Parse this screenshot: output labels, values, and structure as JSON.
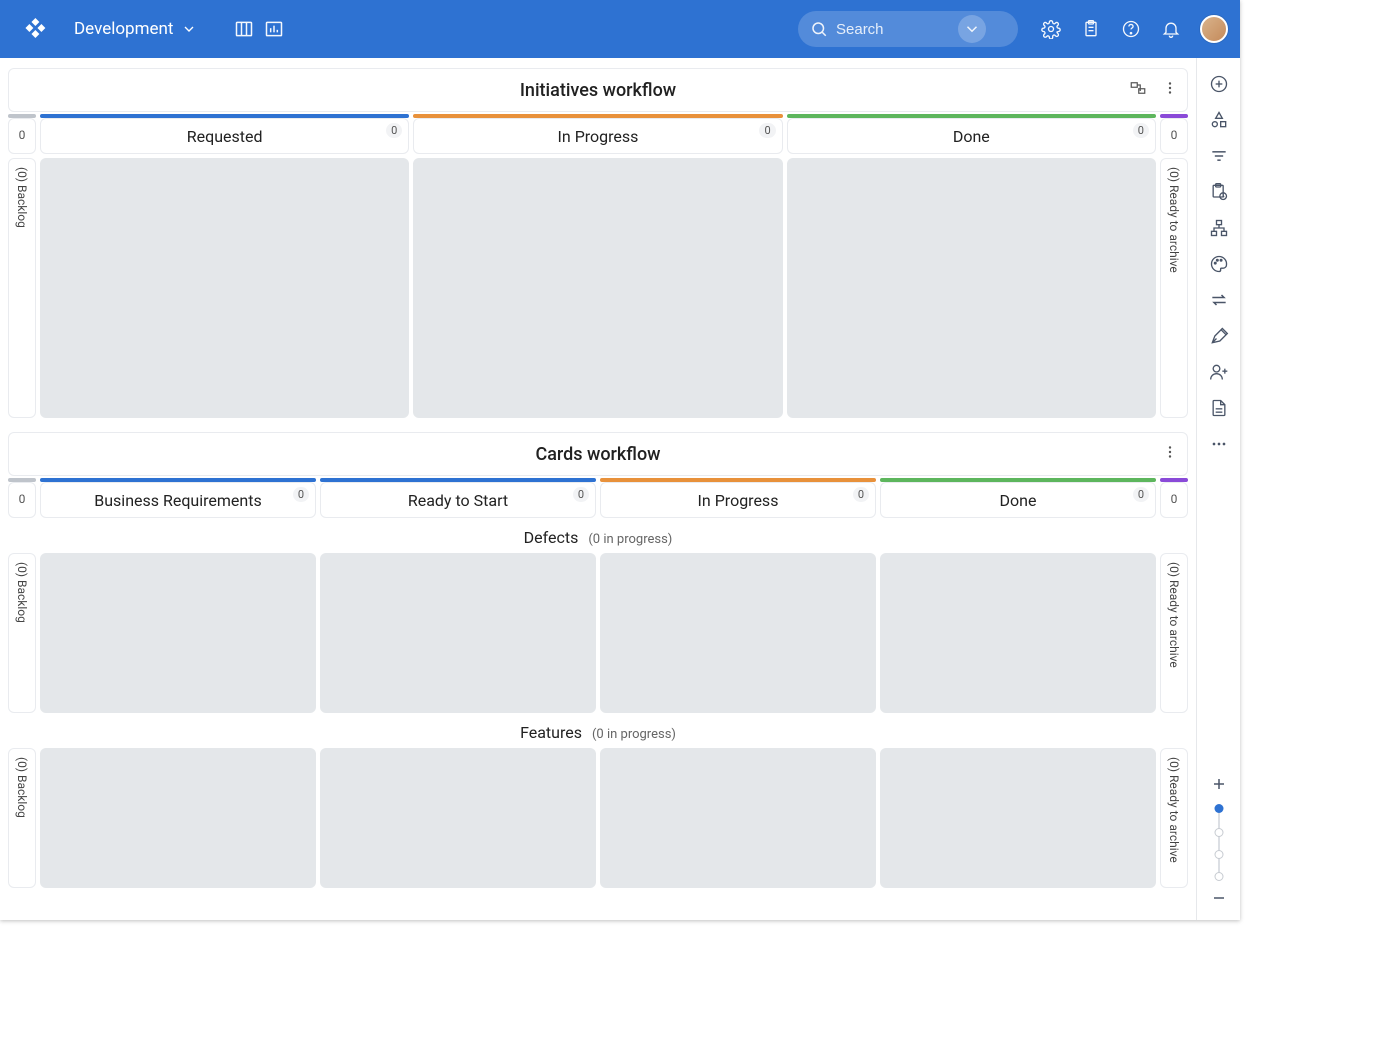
{
  "header": {
    "workspace": "Development",
    "search_placeholder": "Search"
  },
  "rightrail": {
    "tools": [
      "add",
      "shapes",
      "filter",
      "clipboard",
      "hierarchy",
      "palette",
      "swap",
      "design",
      "invite",
      "page",
      "more"
    ]
  },
  "workflows": [
    {
      "id": "initiatives",
      "title": "Initiatives workflow",
      "backlog_label": "(0) Backlog",
      "backlog_count": "0",
      "archive_label": "(0) Ready to archive",
      "archive_count": "0",
      "columns": [
        {
          "label": "Requested",
          "count": "0",
          "color": "#2e72d2"
        },
        {
          "label": "In Progress",
          "count": "0",
          "color": "#e8913b"
        },
        {
          "label": "Done",
          "count": "0",
          "color": "#5db65d"
        }
      ],
      "swimlanes": []
    },
    {
      "id": "cards",
      "title": "Cards workflow",
      "backlog_label": "(0) Backlog",
      "backlog_count": "0",
      "archive_label": "(0) Ready to archive",
      "archive_count": "0",
      "columns": [
        {
          "label": "Business Requirements",
          "count": "0",
          "color": "#2e72d2"
        },
        {
          "label": "Ready to Start",
          "count": "0",
          "color": "#2e72d2"
        },
        {
          "label": "In Progress",
          "count": "0",
          "color": "#e8913b"
        },
        {
          "label": "Done",
          "count": "0",
          "color": "#5db65d"
        }
      ],
      "swimlanes": [
        {
          "label": "Defects",
          "sub": "(0 in progress)"
        },
        {
          "label": "Features",
          "sub": "(0 in progress)"
        }
      ]
    }
  ],
  "colors": {
    "brand": "#2e72d2",
    "backlog_seg": "#bfc4cb",
    "archive_seg": "#8a4ad8"
  }
}
